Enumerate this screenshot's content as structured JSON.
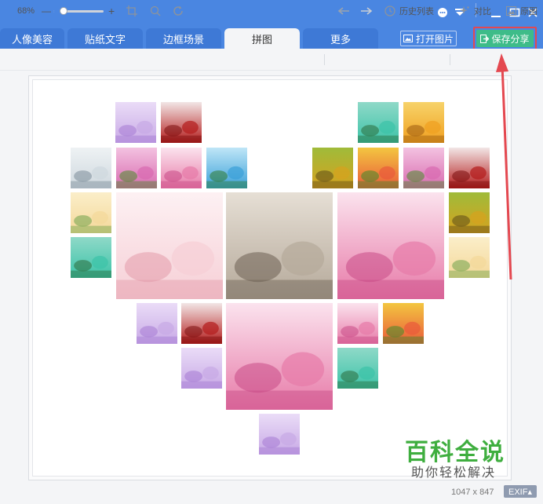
{
  "window": {
    "controls": [
      {
        "name": "feedback-icon",
        "glyph": "☻"
      },
      {
        "name": "menu-icon",
        "glyph": "≡"
      },
      {
        "name": "minimize-icon",
        "glyph": "—"
      },
      {
        "name": "maximize-icon",
        "glyph": "☐"
      },
      {
        "name": "close-icon",
        "glyph": "✕"
      }
    ]
  },
  "tabs": [
    {
      "label": "人像美容",
      "active": false
    },
    {
      "label": "贴纸文字",
      "active": false
    },
    {
      "label": "边框场景",
      "active": false
    },
    {
      "label": "拼图",
      "active": true
    },
    {
      "label": "更多",
      "active": false
    }
  ],
  "header_buttons": {
    "open_label": "打开图片",
    "save_label": "保存分享"
  },
  "toolbar": {
    "zoom_percent": "68%",
    "zoom_minus": "—",
    "zoom_plus": "+",
    "zoom_level": 0.2,
    "history_label": "历史列表",
    "compare_label": "对比",
    "original_label": "原图"
  },
  "status": {
    "dimensions": "1047 x 847",
    "exif_label": "EXIF▴"
  },
  "watermark": {
    "title": "百科全说",
    "subtitle": "助你轻松解决"
  },
  "colors": {
    "brand_blue": "#4a86e1",
    "save_green": "#3ebc89",
    "highlight_red": "#e44850",
    "watermark_green": "#3fae3f"
  },
  "collage_photos": [
    {
      "name": "photo-purple-flowers",
      "theme": "purple"
    },
    {
      "name": "photo-red-roses-small",
      "theme": "rose"
    },
    {
      "name": "photo-lake-green",
      "theme": "lake"
    },
    {
      "name": "photo-autumn-tree",
      "theme": "autumn"
    },
    {
      "name": "photo-beach-sea",
      "theme": "sea"
    },
    {
      "name": "photo-tulips-pink",
      "theme": "tulip"
    },
    {
      "name": "photo-pink-petals",
      "theme": "petal"
    },
    {
      "name": "photo-palm-beach",
      "theme": "palm"
    },
    {
      "name": "photo-autumn-woods",
      "theme": "woods"
    },
    {
      "name": "photo-flower-field",
      "theme": "flowers"
    },
    {
      "name": "photo-tulips-purple",
      "theme": "tulip"
    },
    {
      "name": "photo-red-roses-large",
      "theme": "rose"
    },
    {
      "name": "photo-family-center",
      "theme": "family"
    },
    {
      "name": "photo-teacup-flowers",
      "theme": "teacup"
    },
    {
      "name": "photo-road-sepia",
      "theme": "road"
    },
    {
      "name": "photo-pink-field",
      "theme": "petal"
    },
    {
      "name": "photo-autumn-forest",
      "theme": "woods"
    },
    {
      "name": "photo-green-lake",
      "theme": "lake"
    },
    {
      "name": "photo-family-small",
      "theme": "family"
    },
    {
      "name": "photo-lavender",
      "theme": "purple"
    },
    {
      "name": "photo-rose-bunch",
      "theme": "rose"
    },
    {
      "name": "photo-tree-petals",
      "theme": "petal"
    },
    {
      "name": "photo-pink-sea-flowers",
      "theme": "petal"
    },
    {
      "name": "photo-tulip-garden",
      "theme": "flowers"
    },
    {
      "name": "photo-lilac",
      "theme": "purple"
    },
    {
      "name": "photo-lake-bottom",
      "theme": "lake"
    }
  ]
}
